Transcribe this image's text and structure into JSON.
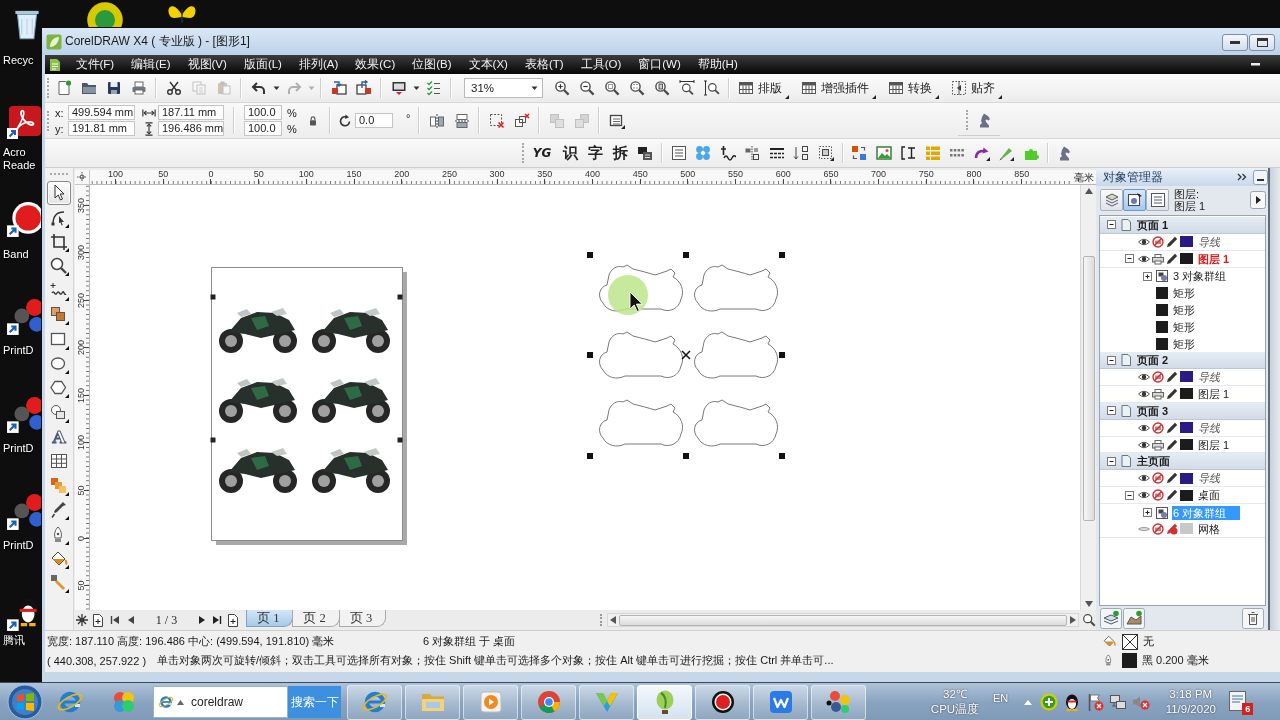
{
  "desktop": {
    "icons": [
      {
        "kind": "recycle",
        "label": "Recyc"
      },
      {
        "kind": "roundapp"
      },
      {
        "kind": "butterfly"
      },
      {
        "kind": "acrobat",
        "label": "Acro Reade"
      },
      {
        "kind": "bandicam",
        "label": "Band"
      },
      {
        "kind": "printd",
        "label": "PrintD"
      },
      {
        "kind": "printd",
        "label": "PrintD"
      },
      {
        "kind": "printd",
        "label": "PrintD"
      },
      {
        "kind": "qq",
        "label": "腾讯"
      }
    ]
  },
  "window": {
    "title": "CorelDRAW X4 ( 专业版 ) - [图形1]",
    "menu": [
      "文件(F)",
      "编辑(E)",
      "视图(V)",
      "版面(L)",
      "排列(A)",
      "效果(C)",
      "位图(B)",
      "文本(X)",
      "表格(T)",
      "工具(O)",
      "窗口(W)",
      "帮助(H)"
    ]
  },
  "standard_toolbar": {
    "items": [
      {
        "kind": "new",
        "disabled": false
      },
      {
        "kind": "open",
        "disabled": false
      },
      {
        "kind": "save",
        "disabled": false
      },
      {
        "kind": "print",
        "disabled": false
      },
      {
        "kind": "separator"
      },
      {
        "kind": "cut",
        "disabled": false
      },
      {
        "kind": "copy",
        "disabled": true
      },
      {
        "kind": "paste",
        "disabled": true
      },
      {
        "kind": "separator"
      },
      {
        "kind": "undo",
        "disabled": false
      },
      {
        "kind": "dropdown",
        "disabled": false
      },
      {
        "kind": "redo",
        "disabled": true
      },
      {
        "kind": "dropdown",
        "disabled": true
      },
      {
        "kind": "separator"
      },
      {
        "kind": "import",
        "disabled": false
      },
      {
        "kind": "export",
        "disabled": false
      },
      {
        "kind": "separator"
      },
      {
        "kind": "launcher",
        "disabled": false
      },
      {
        "kind": "dropdown",
        "disabled": false
      },
      {
        "kind": "options",
        "disabled": false
      },
      {
        "kind": "separator"
      },
      {
        "kind": "zoombox",
        "value": "31%"
      },
      {
        "kind": "zoomin",
        "disabled": false
      },
      {
        "kind": "zoomout",
        "disabled": false
      },
      {
        "kind": "zoomselected",
        "disabled": false
      },
      {
        "kind": "zoomall",
        "disabled": false
      },
      {
        "kind": "zoompage",
        "disabled": false
      },
      {
        "kind": "zoomwidth",
        "disabled": false
      },
      {
        "kind": "zoomheight",
        "disabled": false
      },
      {
        "kind": "separator"
      },
      {
        "kind": "menubutton",
        "label": "排版"
      },
      {
        "kind": "menubutton",
        "label": "增强插件"
      },
      {
        "kind": "menubutton",
        "label": "转换"
      },
      {
        "kind": "snapbutton",
        "label": "贴齐"
      }
    ]
  },
  "property_bar": {
    "position": [
      {
        "label": "x:",
        "value": "499.594 mm"
      },
      {
        "label": "y:",
        "value": "191.81 mm"
      }
    ],
    "size": [
      {
        "kind": "width",
        "value": "187.11 mm"
      },
      {
        "kind": "height",
        "value": "196.486 mm"
      }
    ],
    "scale": [
      {
        "value": "100.0",
        "unit": "%"
      },
      {
        "value": "100.0",
        "unit": "%"
      }
    ],
    "rotation": {
      "value": "0.0",
      "unit": "°"
    },
    "tools": [
      {
        "kind": "mirrorh",
        "disabled": false
      },
      {
        "kind": "mirrorv",
        "disabled": false
      },
      {
        "kind": "separator"
      },
      {
        "kind": "breakbox",
        "disabled": false
      },
      {
        "kind": "unlink",
        "disabled": false
      },
      {
        "kind": "separator"
      },
      {
        "kind": "weld",
        "disabled": true
      },
      {
        "kind": "trim",
        "disabled": true
      },
      {
        "kind": "separator"
      },
      {
        "kind": "frame",
        "disabled": false
      }
    ]
  },
  "plugin_toolbar": {
    "items": [
      {
        "kind": "logo",
        "label": "YG"
      },
      {
        "kind": "glyph",
        "label": "识"
      },
      {
        "kind": "glyph",
        "label": "字"
      },
      {
        "kind": "glyph",
        "label": "拆"
      },
      {
        "kind": "stamp"
      },
      {
        "kind": "separator"
      },
      {
        "kind": "table"
      },
      {
        "kind": "flower"
      },
      {
        "kind": "wave"
      },
      {
        "kind": "align"
      },
      {
        "kind": "lines"
      },
      {
        "kind": "distribute"
      },
      {
        "kind": "dashsel"
      },
      {
        "kind": "separator"
      },
      {
        "kind": "swap"
      },
      {
        "kind": "picture"
      },
      {
        "kind": "bracket"
      },
      {
        "kind": "bullets"
      },
      {
        "kind": "dotgrid"
      },
      {
        "kind": "curvearrow"
      },
      {
        "kind": "pen"
      },
      {
        "kind": "puzzle"
      },
      {
        "kind": "separator"
      },
      {
        "kind": "horse"
      }
    ]
  },
  "toolbox": [
    {
      "kind": "pick",
      "selected": true
    },
    {
      "kind": "shape",
      "selected": false
    },
    {
      "kind": "crop",
      "selected": false
    },
    {
      "kind": "zoom",
      "selected": false
    },
    {
      "kind": "freehand",
      "selected": false
    },
    {
      "kind": "smartfill",
      "selected": false
    },
    {
      "kind": "rectangle",
      "selected": false
    },
    {
      "kind": "ellipse",
      "selected": false
    },
    {
      "kind": "polygon",
      "selected": false
    },
    {
      "kind": "shapes",
      "selected": false
    },
    {
      "kind": "text",
      "label": "A",
      "selected": false
    },
    {
      "kind": "table",
      "selected": false
    },
    {
      "kind": "blend",
      "selected": false
    },
    {
      "kind": "eyedropper",
      "selected": false
    },
    {
      "kind": "outline",
      "selected": false
    },
    {
      "kind": "fill",
      "selected": false
    },
    {
      "kind": "interactivefill",
      "selected": false
    }
  ],
  "rulers": {
    "horizontal": [
      "100",
      "50",
      "0",
      "50",
      "100",
      "150",
      "200",
      "250",
      "300",
      "350",
      "400",
      "450",
      "500",
      "550",
      "600",
      "650",
      "700",
      "750",
      "800",
      "850"
    ],
    "unit": "毫米",
    "vertical": [
      "350",
      "300",
      "250",
      "200",
      "150",
      "100",
      "50",
      "0",
      "50"
    ]
  },
  "page_navigation": {
    "counter": "1 / 3",
    "tabs": [
      {
        "label": "页 1",
        "selected": true
      },
      {
        "label": "页 2",
        "selected": false
      },
      {
        "label": "页 3",
        "selected": false
      }
    ]
  },
  "object_manager": {
    "title": "对象管理器",
    "view_buttons": [
      {
        "kind": "pages",
        "selected": false
      },
      {
        "kind": "objects",
        "selected": true
      },
      {
        "kind": "layers",
        "selected": false
      }
    ],
    "layer_caption": "图层:",
    "layer_name": "图层 1",
    "tree": [
      {
        "kind": "page",
        "label": "页面 1",
        "expanded": true,
        "selected": false,
        "children": [
          {
            "kind": "guides",
            "label": "导线",
            "visible": true,
            "printable": false,
            "editable": true,
            "color": "#2b1b84",
            "active": false,
            "selected": false
          },
          {
            "kind": "layer",
            "label": "图层 1",
            "visible": true,
            "printable": true,
            "editable": true,
            "color": "#1c1c1c",
            "active": true,
            "selected": false,
            "expanded": true,
            "children": [
              {
                "kind": "group",
                "label": "3 对象群组",
                "expanded": false,
                "selected": false
              },
              {
                "kind": "rectangle",
                "label": "矩形",
                "selected": false
              },
              {
                "kind": "rectangle",
                "label": "矩形",
                "selected": false
              },
              {
                "kind": "rectangle",
                "label": "矩形",
                "selected": false
              },
              {
                "kind": "rectangle",
                "label": "矩形",
                "selected": false
              }
            ]
          }
        ]
      },
      {
        "kind": "page",
        "label": "页面 2",
        "expanded": true,
        "selected": false,
        "children": [
          {
            "kind": "guides",
            "label": "导线",
            "visible": true,
            "printable": false,
            "editable": true,
            "color": "#2b1b84",
            "active": false,
            "selected": false
          },
          {
            "kind": "layer",
            "label": "图层 1",
            "visible": true,
            "printable": true,
            "editable": true,
            "color": "#1c1c1c",
            "active": false,
            "selected": false
          }
        ]
      },
      {
        "kind": "page",
        "label": "页面 3",
        "expanded": true,
        "selected": false,
        "children": [
          {
            "kind": "guides",
            "label": "导线",
            "visible": true,
            "printable": false,
            "editable": true,
            "color": "#2b1b84",
            "active": false,
            "selected": false
          },
          {
            "kind": "layer",
            "label": "图层 1",
            "visible": true,
            "printable": true,
            "editable": true,
            "color": "#1c1c1c",
            "active": false,
            "selected": false
          }
        ]
      },
      {
        "kind": "page",
        "label": "主页面",
        "expanded": true,
        "selected": false,
        "children": [
          {
            "kind": "guides",
            "label": "导线",
            "visible": true,
            "printable": false,
            "editable": true,
            "color": "#2b1b84",
            "active": false,
            "selected": false
          },
          {
            "kind": "layer",
            "label": "桌面",
            "visible": true,
            "printable": false,
            "editable": true,
            "color": "#1c1c1c",
            "active": false,
            "selected": false,
            "expanded": true,
            "children": [
              {
                "kind": "group",
                "label": "6 对象群组",
                "expanded": false,
                "selected": true
              }
            ]
          },
          {
            "kind": "layer",
            "label": "网格",
            "visible": false,
            "printable": false,
            "editable": false,
            "color": "#c8c8c8",
            "active": false,
            "selected": false
          }
        ]
      }
    ]
  },
  "status_bar": {
    "dimensions": "宽度: 187.110 高度: 196.486 中心: (499.594, 191.810) 毫米",
    "selection": "6 对象群组 于 桌面",
    "cursor": "( 440.308, 257.922 )",
    "hint": "单击对象两次可旋转/倾斜；双击工具可选择所有对象；按住 Shift 键单击可选择多个对象；按住 Alt 键单击可进行挖掘；按住 Ctrl 并单击可...",
    "fill": "无",
    "outline": "黑 0.200 毫米"
  },
  "taskbar": {
    "pinned": [
      {
        "kind": "ie"
      },
      {
        "kind": "pinwheel"
      }
    ],
    "search": {
      "value": "coreldraw",
      "button": "搜索一下"
    },
    "apps": [
      {
        "kind": "ie",
        "active": false
      },
      {
        "kind": "folder",
        "active": false
      },
      {
        "kind": "media",
        "active": false
      },
      {
        "kind": "chrome",
        "active": false
      },
      {
        "kind": "vshape",
        "active": false
      },
      {
        "kind": "corel",
        "active": true
      },
      {
        "kind": "record",
        "active": false
      },
      {
        "kind": "wps",
        "active": false
      },
      {
        "kind": "balls",
        "active": false
      }
    ],
    "temperature": "32℃",
    "temperature_label": "CPU温度",
    "language": "EN",
    "tray": [
      {
        "kind": "plus"
      },
      {
        "kind": "penguin"
      },
      {
        "kind": "flag"
      },
      {
        "kind": "network"
      },
      {
        "kind": "speaker"
      }
    ],
    "time": "3:18 PM",
    "date": "11/9/2020",
    "notification_count": "6"
  }
}
